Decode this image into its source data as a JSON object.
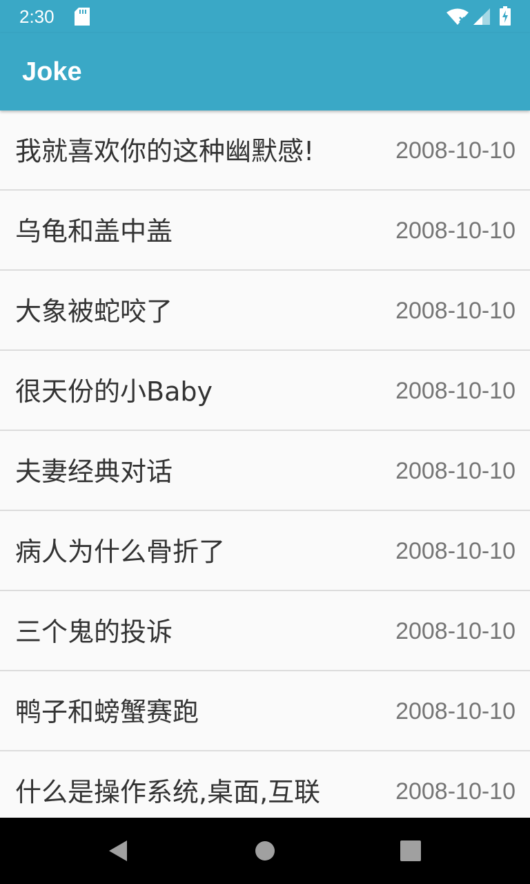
{
  "status_bar": {
    "time": "2:30",
    "icons": [
      "sd-card-icon",
      "wifi-icon",
      "signal-icon",
      "battery-charging-icon"
    ]
  },
  "app_bar": {
    "title": "Joke"
  },
  "jokes": [
    {
      "title": "我就喜欢你的这种幽默感!",
      "date": "2008-10-10"
    },
    {
      "title": "乌龟和盖中盖",
      "date": "2008-10-10"
    },
    {
      "title": "大象被蛇咬了",
      "date": "2008-10-10"
    },
    {
      "title": "很天份的小Baby",
      "date": "2008-10-10"
    },
    {
      "title": "夫妻经典对话",
      "date": "2008-10-10"
    },
    {
      "title": "病人为什么骨折了",
      "date": "2008-10-10"
    },
    {
      "title": "三个鬼的投诉",
      "date": "2008-10-10"
    },
    {
      "title": "鸭子和螃蟹赛跑",
      "date": "2008-10-10"
    },
    {
      "title": "什么是操作系统,桌面,互联",
      "date": "2008-10-10"
    }
  ],
  "nav_bar": {
    "icons": [
      "back-icon",
      "home-icon",
      "recent-apps-icon"
    ]
  },
  "colors": {
    "primary": "#3aa8c6",
    "title_text": "#333333",
    "date_text": "#757575",
    "divider": "#dcdcdc",
    "background": "#fafafa"
  }
}
